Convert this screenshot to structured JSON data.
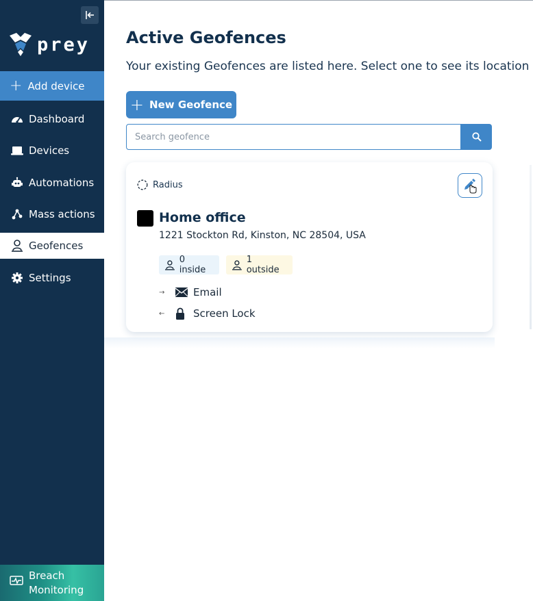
{
  "sidebar": {
    "logo_text": "prey",
    "add_device_label": "Add device",
    "items": [
      {
        "label": "Dashboard",
        "icon": "gauge-icon"
      },
      {
        "label": "Devices",
        "icon": "laptop-icon"
      },
      {
        "label": "Automations",
        "icon": "robot-icon"
      },
      {
        "label": "Mass actions",
        "icon": "nodes-icon"
      },
      {
        "label": "Geofences",
        "icon": "geofence-pin-icon",
        "active": true
      },
      {
        "label": "Settings",
        "icon": "gear-icon"
      }
    ],
    "breach_line1": "Breach",
    "breach_line2": "Monitoring"
  },
  "main": {
    "title": "Active Geofences",
    "subtitle": "Your existing Geofences are listed here. Select one to see its location",
    "new_button_label": "New Geofence",
    "search": {
      "placeholder": "Search geofence",
      "value": ""
    }
  },
  "geofence_card": {
    "type_label": "Radius",
    "name": "Home office",
    "color": "#000000",
    "address": "1221 Stockton Rd, Kinston, NC 28504, USA",
    "inside_label": "0 inside",
    "outside_label": "1 outside",
    "actions": [
      {
        "direction": "→",
        "icon": "envelope-icon",
        "label": "Email"
      },
      {
        "direction": "←",
        "icon": "lock-icon",
        "label": "Screen Lock"
      }
    ]
  },
  "colors": {
    "sidebar_bg": "#12304d",
    "accent": "#3f86c8",
    "title": "#12304d"
  }
}
